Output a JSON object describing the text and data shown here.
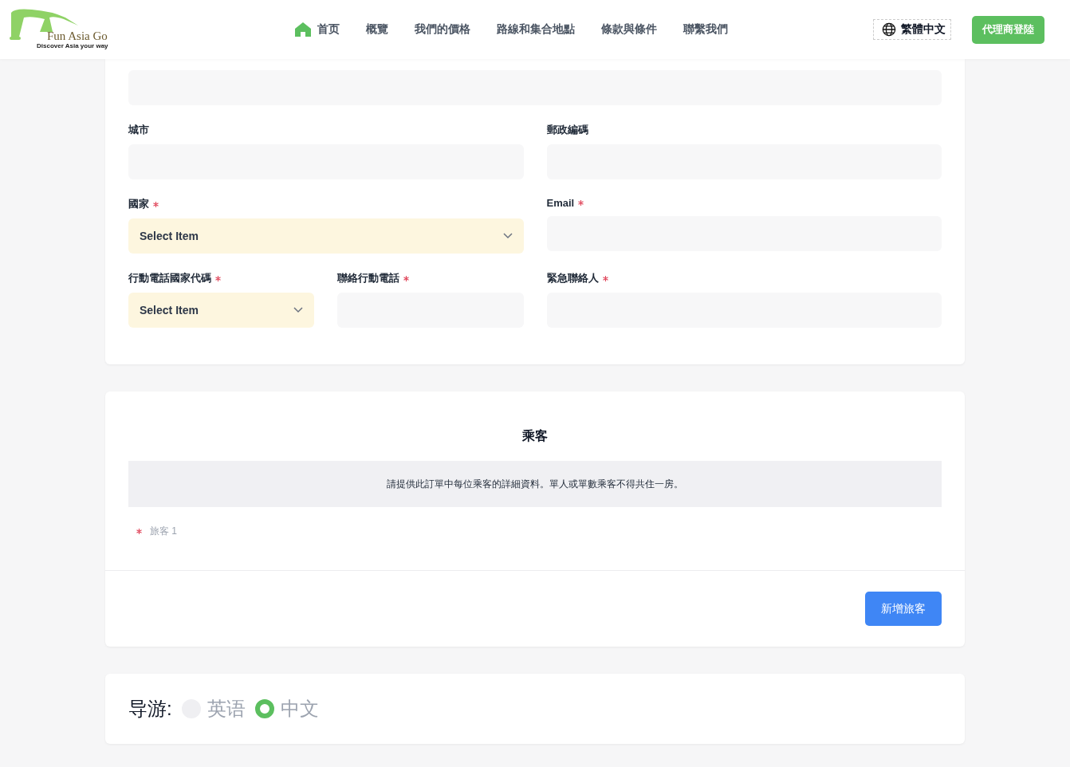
{
  "header": {
    "logo": {
      "name": "Fun Asia Go",
      "tagline": "Discover Asia your way"
    },
    "nav": [
      {
        "label": "首页",
        "kind": "home"
      },
      {
        "label": "概覽",
        "kind": "plain"
      },
      {
        "label": "我們的價格",
        "kind": "plain"
      },
      {
        "label": "路線和集合地點",
        "kind": "plain"
      },
      {
        "label": "條款與條件",
        "kind": "plain"
      },
      {
        "label": "聯繫我們",
        "kind": "plain"
      }
    ],
    "language": "繁體中文",
    "agent_login": "代理商登陸"
  },
  "contact_form": {
    "rows": [
      {
        "fields": [
          {
            "kind": "input"
          }
        ]
      },
      {
        "fields": [
          {
            "kind": "input",
            "label": "城市",
            "required": false
          },
          {
            "kind": "input",
            "label": "郵政編碼",
            "required": false
          }
        ]
      },
      {
        "fields": [
          {
            "kind": "select",
            "label": "國家",
            "required": true,
            "value": "Select Item"
          },
          {
            "kind": "input",
            "label": "Email",
            "required": true
          }
        ]
      },
      {
        "fields": [
          {
            "kind": "select",
            "label": "行動電話國家代碼",
            "required": true,
            "value": "Select Item"
          },
          {
            "kind": "input",
            "label": "聯絡行動電話",
            "required": true
          },
          {
            "kind": "input",
            "label": "緊急聯絡人",
            "required": true
          }
        ]
      }
    ]
  },
  "passengers": {
    "title": "乘客",
    "notice": "請提供此訂單中每位乘客的詳細資料。單人或單數乘客不得共住一房。",
    "travelers": [
      {
        "label": "旅客 1",
        "required": true
      }
    ],
    "add_button": "新增旅客"
  },
  "guide": {
    "label": "导游:",
    "options": [
      {
        "label": "英语",
        "selected": false
      },
      {
        "label": "中文",
        "selected": true
      }
    ]
  }
}
